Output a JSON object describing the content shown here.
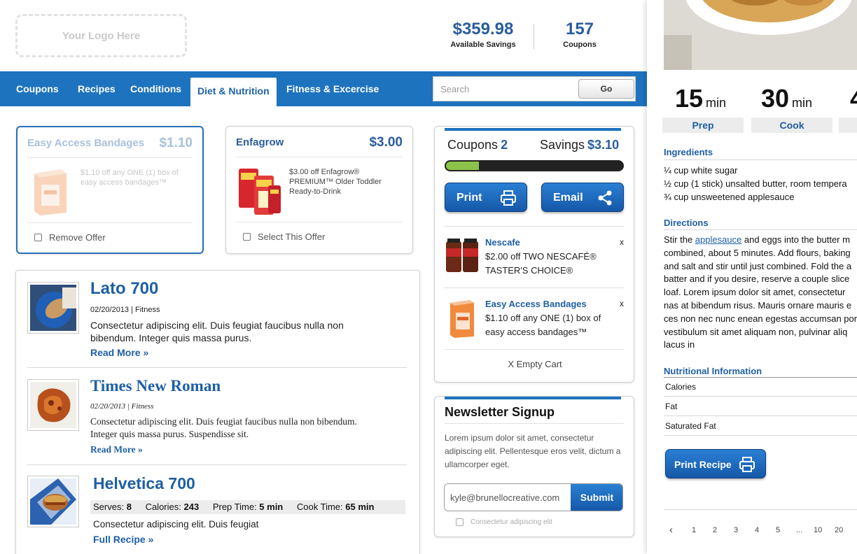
{
  "header": {
    "logo_text": "Your Logo Here",
    "savings_value": "$359.98",
    "savings_label": "Available Savings",
    "coupons_value": "157",
    "coupons_label": "Coupons"
  },
  "nav": {
    "items": [
      "Coupons",
      "Recipes",
      "Conditions",
      "Diet & Nutrition",
      "Fitness & Excercise"
    ],
    "active_index": 3,
    "search_placeholder": "Search",
    "go_label": "Go"
  },
  "offers": [
    {
      "title": "Easy Access Bandages",
      "price": "$1.10",
      "desc": "$1.10 off any ONE (1) box of easy access bandages™",
      "action": "Remove Offer",
      "selected": true
    },
    {
      "title": "Enfagrow",
      "price": "$3.00",
      "desc": "$3.00 off Enfagrow® PREMIUM™ Older Toddler Ready-to-Drink",
      "action": "Select This Offer",
      "selected": false
    }
  ],
  "articles": [
    {
      "title": "Lato 700",
      "meta": "02/20/2013 | Fitness",
      "text": "Consectetur adipiscing elit. Duis feugiat faucibus nulla non bibendum. Integer quis massa purus.",
      "more": "Read More »"
    },
    {
      "title": "Times New Roman",
      "meta": "02/20/2013 | Fitness",
      "text": "Consectetur adipiscing elit. Duis feugiat faucibus nulla non bibendum. Integer quis massa purus. Suspendisse sit.",
      "more": "Read More »"
    },
    {
      "title": "Helvetica 700",
      "stats": {
        "serves_label": "Serves:",
        "serves": "8",
        "calories_label": "Calories:",
        "calories": "243",
        "prep_label": "Prep Time:",
        "prep": "5 min",
        "cook_label": "Cook Time:",
        "cook": "65 min"
      },
      "text": "Consectetur adipiscing elit. Duis feugiat",
      "more": "Full Recipe »"
    }
  ],
  "cart": {
    "coupons_label": "Coupons",
    "coupons_count": "2",
    "savings_label": "Savings",
    "savings_value": "$3.10",
    "progress": 0.2,
    "print_label": "Print",
    "email_label": "Email",
    "items": [
      {
        "title": "Nescafe",
        "desc": "$2.00 off TWO NESCAFÉ® TASTER'S CHOICE®",
        "remove": "x"
      },
      {
        "title": "Easy Access Bandages",
        "desc": "$1.10 off any ONE (1) box of easy access bandages™",
        "remove": "x"
      }
    ],
    "empty_label": "X Empty Cart"
  },
  "newsletter": {
    "title": "Newsletter Signup",
    "text": "Lorem ipsum dolor sit amet, consectetur adipiscing elit. Pellentesque eros velit, dictum a ullamcorper eget.",
    "email_value": "kyle@brunellocreative.com",
    "submit_label": "Submit",
    "check_label": "Consectetur adipiscing elit"
  },
  "recipe": {
    "prep_value": "15",
    "prep_unit": "min",
    "prep_label": "Prep",
    "cook_value": "30",
    "cook_unit": "min",
    "cook_label": "Cook",
    "third_value": "4",
    "ingredients_title": "Ingredients",
    "ingredients": [
      "¼ cup white sugar",
      "½ cup (1 stick) unsalted butter, room tempera",
      "¾ cup unsweetened applesauce"
    ],
    "directions_title": "Directions",
    "directions_lead": "Stir the ",
    "directions_link": "applesauce",
    "directions_first_rest": " and eggs into the butter m",
    "directions_lines": [
      "combined, about 5 minutes. Add flours, baking",
      "and salt and stir until just combined. Fold the a",
      "batter and if you desire, reserve a couple slice",
      "loaf. Lorem ipsum dolor sit amet, consectetur",
      "nas at bibendum risus. Mauris ornare mauris e",
      "ces non nec nunc enean egestas accumsan por",
      "vestibulum sit amet aliquam non, pulvinar aliq",
      "lacus in"
    ],
    "nutrition_title": "Nutritional Information",
    "nutrition": [
      "Calories",
      "Fat",
      "Saturated Fat"
    ],
    "print_label": "Print Recipe",
    "pager": [
      "‹",
      "1",
      "2",
      "3",
      "4",
      "5",
      "...",
      "10",
      "20"
    ]
  },
  "colors": {
    "brand_blue": "#1e73be",
    "link_blue": "#1e5fa4",
    "progress_green": "#8bc34a"
  }
}
